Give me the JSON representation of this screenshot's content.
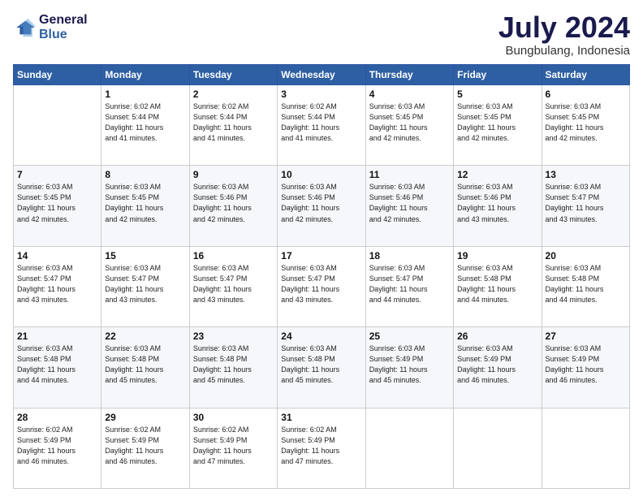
{
  "header": {
    "logo_line1": "General",
    "logo_line2": "Blue",
    "month": "July 2024",
    "location": "Bungbulang, Indonesia"
  },
  "weekdays": [
    "Sunday",
    "Monday",
    "Tuesday",
    "Wednesday",
    "Thursday",
    "Friday",
    "Saturday"
  ],
  "weeks": [
    [
      {
        "day": "",
        "info": ""
      },
      {
        "day": "1",
        "info": "Sunrise: 6:02 AM\nSunset: 5:44 PM\nDaylight: 11 hours\nand 41 minutes."
      },
      {
        "day": "2",
        "info": "Sunrise: 6:02 AM\nSunset: 5:44 PM\nDaylight: 11 hours\nand 41 minutes."
      },
      {
        "day": "3",
        "info": "Sunrise: 6:02 AM\nSunset: 5:44 PM\nDaylight: 11 hours\nand 41 minutes."
      },
      {
        "day": "4",
        "info": "Sunrise: 6:03 AM\nSunset: 5:45 PM\nDaylight: 11 hours\nand 42 minutes."
      },
      {
        "day": "5",
        "info": "Sunrise: 6:03 AM\nSunset: 5:45 PM\nDaylight: 11 hours\nand 42 minutes."
      },
      {
        "day": "6",
        "info": "Sunrise: 6:03 AM\nSunset: 5:45 PM\nDaylight: 11 hours\nand 42 minutes."
      }
    ],
    [
      {
        "day": "7",
        "info": "Sunrise: 6:03 AM\nSunset: 5:45 PM\nDaylight: 11 hours\nand 42 minutes."
      },
      {
        "day": "8",
        "info": "Sunrise: 6:03 AM\nSunset: 5:45 PM\nDaylight: 11 hours\nand 42 minutes."
      },
      {
        "day": "9",
        "info": "Sunrise: 6:03 AM\nSunset: 5:46 PM\nDaylight: 11 hours\nand 42 minutes."
      },
      {
        "day": "10",
        "info": "Sunrise: 6:03 AM\nSunset: 5:46 PM\nDaylight: 11 hours\nand 42 minutes."
      },
      {
        "day": "11",
        "info": "Sunrise: 6:03 AM\nSunset: 5:46 PM\nDaylight: 11 hours\nand 42 minutes."
      },
      {
        "day": "12",
        "info": "Sunrise: 6:03 AM\nSunset: 5:46 PM\nDaylight: 11 hours\nand 43 minutes."
      },
      {
        "day": "13",
        "info": "Sunrise: 6:03 AM\nSunset: 5:47 PM\nDaylight: 11 hours\nand 43 minutes."
      }
    ],
    [
      {
        "day": "14",
        "info": "Sunrise: 6:03 AM\nSunset: 5:47 PM\nDaylight: 11 hours\nand 43 minutes."
      },
      {
        "day": "15",
        "info": "Sunrise: 6:03 AM\nSunset: 5:47 PM\nDaylight: 11 hours\nand 43 minutes."
      },
      {
        "day": "16",
        "info": "Sunrise: 6:03 AM\nSunset: 5:47 PM\nDaylight: 11 hours\nand 43 minutes."
      },
      {
        "day": "17",
        "info": "Sunrise: 6:03 AM\nSunset: 5:47 PM\nDaylight: 11 hours\nand 43 minutes."
      },
      {
        "day": "18",
        "info": "Sunrise: 6:03 AM\nSunset: 5:47 PM\nDaylight: 11 hours\nand 44 minutes."
      },
      {
        "day": "19",
        "info": "Sunrise: 6:03 AM\nSunset: 5:48 PM\nDaylight: 11 hours\nand 44 minutes."
      },
      {
        "day": "20",
        "info": "Sunrise: 6:03 AM\nSunset: 5:48 PM\nDaylight: 11 hours\nand 44 minutes."
      }
    ],
    [
      {
        "day": "21",
        "info": "Sunrise: 6:03 AM\nSunset: 5:48 PM\nDaylight: 11 hours\nand 44 minutes."
      },
      {
        "day": "22",
        "info": "Sunrise: 6:03 AM\nSunset: 5:48 PM\nDaylight: 11 hours\nand 45 minutes."
      },
      {
        "day": "23",
        "info": "Sunrise: 6:03 AM\nSunset: 5:48 PM\nDaylight: 11 hours\nand 45 minutes."
      },
      {
        "day": "24",
        "info": "Sunrise: 6:03 AM\nSunset: 5:48 PM\nDaylight: 11 hours\nand 45 minutes."
      },
      {
        "day": "25",
        "info": "Sunrise: 6:03 AM\nSunset: 5:49 PM\nDaylight: 11 hours\nand 45 minutes."
      },
      {
        "day": "26",
        "info": "Sunrise: 6:03 AM\nSunset: 5:49 PM\nDaylight: 11 hours\nand 46 minutes."
      },
      {
        "day": "27",
        "info": "Sunrise: 6:03 AM\nSunset: 5:49 PM\nDaylight: 11 hours\nand 46 minutes."
      }
    ],
    [
      {
        "day": "28",
        "info": "Sunrise: 6:02 AM\nSunset: 5:49 PM\nDaylight: 11 hours\nand 46 minutes."
      },
      {
        "day": "29",
        "info": "Sunrise: 6:02 AM\nSunset: 5:49 PM\nDaylight: 11 hours\nand 46 minutes."
      },
      {
        "day": "30",
        "info": "Sunrise: 6:02 AM\nSunset: 5:49 PM\nDaylight: 11 hours\nand 47 minutes."
      },
      {
        "day": "31",
        "info": "Sunrise: 6:02 AM\nSunset: 5:49 PM\nDaylight: 11 hours\nand 47 minutes."
      },
      {
        "day": "",
        "info": ""
      },
      {
        "day": "",
        "info": ""
      },
      {
        "day": "",
        "info": ""
      }
    ]
  ]
}
